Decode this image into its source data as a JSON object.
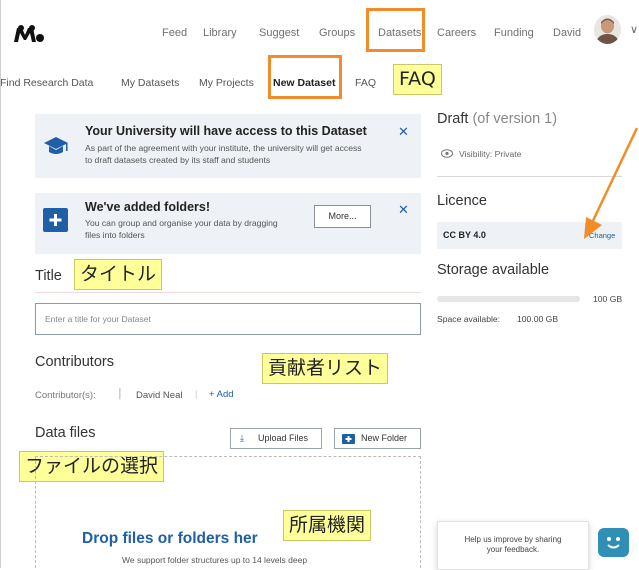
{
  "nav": {
    "items": [
      "Feed",
      "Library",
      "Suggest",
      "Groups",
      "Datasets",
      "Careers",
      "Funding",
      "David"
    ]
  },
  "subnav": {
    "items": [
      "Find Research Data",
      "My Datasets",
      "My Projects",
      "New Dataset",
      "FAQ"
    ]
  },
  "annotations": {
    "faq": "FAQ",
    "title": "タイトル",
    "contributors": "貢献者リスト",
    "files": "ファイルの選択",
    "affiliation": "所属機関"
  },
  "notice_access": {
    "title": "Your University will have access to this Dataset",
    "line1": "As part of the agreement with your institute, the university will get access",
    "line2": "to draft datasets created by its staff and students"
  },
  "notice_folders": {
    "title": "We've added folders!",
    "line1": "You can group and organise your data by dragging",
    "line2": "files into folders",
    "more_label": "More..."
  },
  "form": {
    "title_heading": "Title",
    "title_placeholder": "Enter a title for your Dataset",
    "contributors_heading": "Contributors",
    "contributors_label": "Contributor(s):",
    "contributor_name": "David Neal",
    "add_label": "+ Add",
    "datafiles_heading": "Data files",
    "upload_label": "Upload Files",
    "newfolder_label": "New Folder",
    "drop_heading": "Drop files or folders her",
    "drop_sub": "We support folder structures up to 14 levels deep"
  },
  "sidebar": {
    "draft": "Draft",
    "version": "(of version 1)",
    "visibility": "Visibility: Private",
    "licence_heading": "Licence",
    "licence_value": "CC BY 4.0",
    "change_label": "Change",
    "storage_heading": "Storage available",
    "storage_total": "100 GB",
    "storage_used_fraction": 0,
    "space_label": "Space available:",
    "space_value": "100.00 GB"
  },
  "feedback": {
    "line1": "Help us improve by sharing",
    "line2": "your feedback."
  },
  "colors": {
    "accent_blue": "#1f5fa6",
    "annotation_orange": "#f28c28",
    "annotation_yellow": "#ffff99",
    "bot_teal": "#2f8fb6"
  },
  "icons": [
    "mendeley-logo",
    "graduation-cap-icon",
    "add-folder-icon",
    "close-icon",
    "eye-icon",
    "upload-icon",
    "new-folder-icon",
    "chevron-down-icon",
    "chatbot-icon"
  ]
}
